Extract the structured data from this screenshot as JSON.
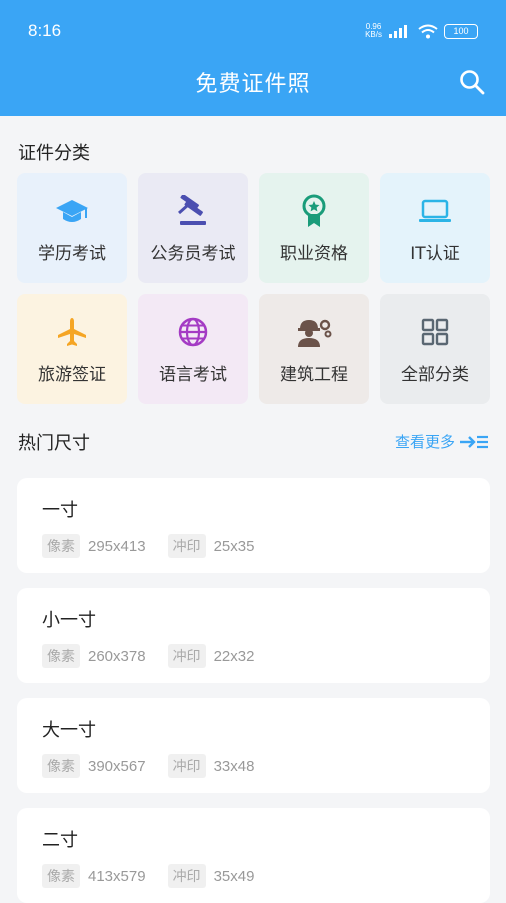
{
  "status_bar": {
    "time": "8:16",
    "speed_value": "0.96",
    "speed_unit": "KB/s",
    "battery": "100"
  },
  "header": {
    "title": "免费证件照",
    "search_icon": "search-icon"
  },
  "categories_section": {
    "title": "证件分类",
    "items": [
      {
        "label": "学历考试",
        "icon": "graduation-cap-icon",
        "bg": "#e8f1fb",
        "color": "#3aa5f5"
      },
      {
        "label": "公务员考试",
        "icon": "gavel-icon",
        "bg": "#eaeaf4",
        "color": "#4b4fb0"
      },
      {
        "label": "职业资格",
        "icon": "award-badge-icon",
        "bg": "#e5f3ee",
        "color": "#1a9c7a"
      },
      {
        "label": "IT认证",
        "icon": "laptop-icon",
        "bg": "#e4f3fb",
        "color": "#2bb4e6"
      },
      {
        "label": "旅游签证",
        "icon": "airplane-icon",
        "bg": "#fcf3e1",
        "color": "#f5a524"
      },
      {
        "label": "语言考试",
        "icon": "globe-icon",
        "bg": "#f3e9f5",
        "color": "#a43bc4"
      },
      {
        "label": "建筑工程",
        "icon": "engineer-icon",
        "bg": "#eeeae8",
        "color": "#6b534a"
      },
      {
        "label": "全部分类",
        "icon": "grid-icon",
        "bg": "#eaecee",
        "color": "#5a6772"
      }
    ]
  },
  "hot_sizes": {
    "title": "热门尺寸",
    "more_label": "查看更多",
    "pixel_tag": "像素",
    "print_tag": "冲印",
    "items": [
      {
        "name": "一寸",
        "pixels": "295x413",
        "print": "25x35"
      },
      {
        "name": "小一寸",
        "pixels": "260x378",
        "print": "22x32"
      },
      {
        "name": "大一寸",
        "pixels": "390x567",
        "print": "33x48"
      },
      {
        "name": "二寸",
        "pixels": "413x579",
        "print": "35x49"
      }
    ]
  }
}
